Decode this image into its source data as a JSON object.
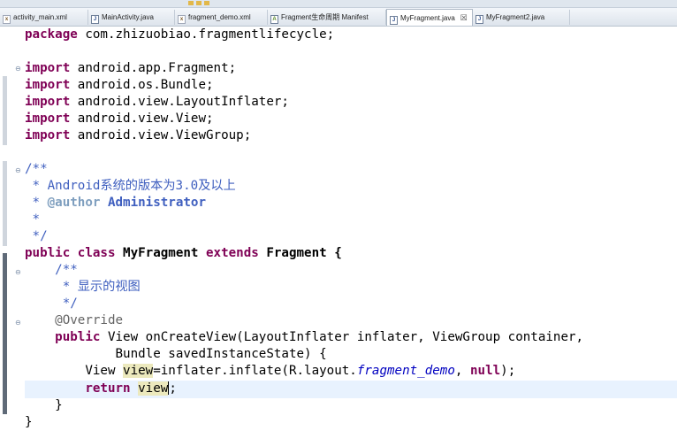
{
  "tabs": [
    {
      "label": "activity_main.xml",
      "icon": "xml-file-icon",
      "active": false
    },
    {
      "label": "MainActivity.java",
      "icon": "java-file-icon",
      "active": false
    },
    {
      "label": "fragment_demo.xml",
      "icon": "xml-file-icon",
      "active": false
    },
    {
      "label": "Fragment生命周期 Manifest",
      "icon": "manifest-file-icon",
      "active": false
    },
    {
      "label": "MyFragment.java",
      "icon": "java-file-icon",
      "active": true,
      "close": "☒"
    },
    {
      "label": "MyFragment2.java",
      "icon": "java-file-icon",
      "active": false
    }
  ],
  "code": {
    "l1": {
      "kw": "package",
      "rest": " com.zhizuobiao.fragmentlifecycle;"
    },
    "l3": {
      "kw": "import",
      "rest": " android.app.Fragment;"
    },
    "l4": {
      "kw": "import",
      "rest": " android.os.Bundle;"
    },
    "l5": {
      "kw": "import",
      "rest": " android.view.LayoutInflater;"
    },
    "l6": {
      "kw": "import",
      "rest": " android.view.View;"
    },
    "l7": {
      "kw": "import",
      "rest": " android.view.ViewGroup;"
    },
    "l9": {
      "text": "/**"
    },
    "l10": {
      "text": " * Android系统的版本为3.0及以上"
    },
    "l11": {
      "pre": " * ",
      "tag": "@author",
      "rest": " Administrator"
    },
    "l12": {
      "text": " *"
    },
    "l13": {
      "text": " */"
    },
    "l14": {
      "kw1": "public",
      "kw2": " class",
      "mid": " MyFragment ",
      "kw3": "extends",
      "rest": " Fragment {"
    },
    "l15": {
      "text": "    /**"
    },
    "l16": {
      "text": "     * 显示的视图"
    },
    "l17": {
      "text": "     */"
    },
    "l18": {
      "indent": "    ",
      "ann": "@Override"
    },
    "l19": {
      "indent": "    ",
      "kw": "public",
      "rest": " View onCreateView(LayoutInflater inflater, ViewGroup container,"
    },
    "l20": {
      "text": "            Bundle savedInstanceState) {"
    },
    "l21": {
      "pre": "        View ",
      "occ": "view",
      "mid": "=inflater.inflate(R.layout.",
      "fld": "fragment_demo",
      "mid2": ", ",
      "kw": "null",
      "rest": ");"
    },
    "l22": {
      "indent": "        ",
      "kw": "return",
      "sp": " ",
      "occ": "view",
      "rest": ";"
    },
    "l23": {
      "text": "    }"
    },
    "l24": {
      "text": "}"
    }
  }
}
